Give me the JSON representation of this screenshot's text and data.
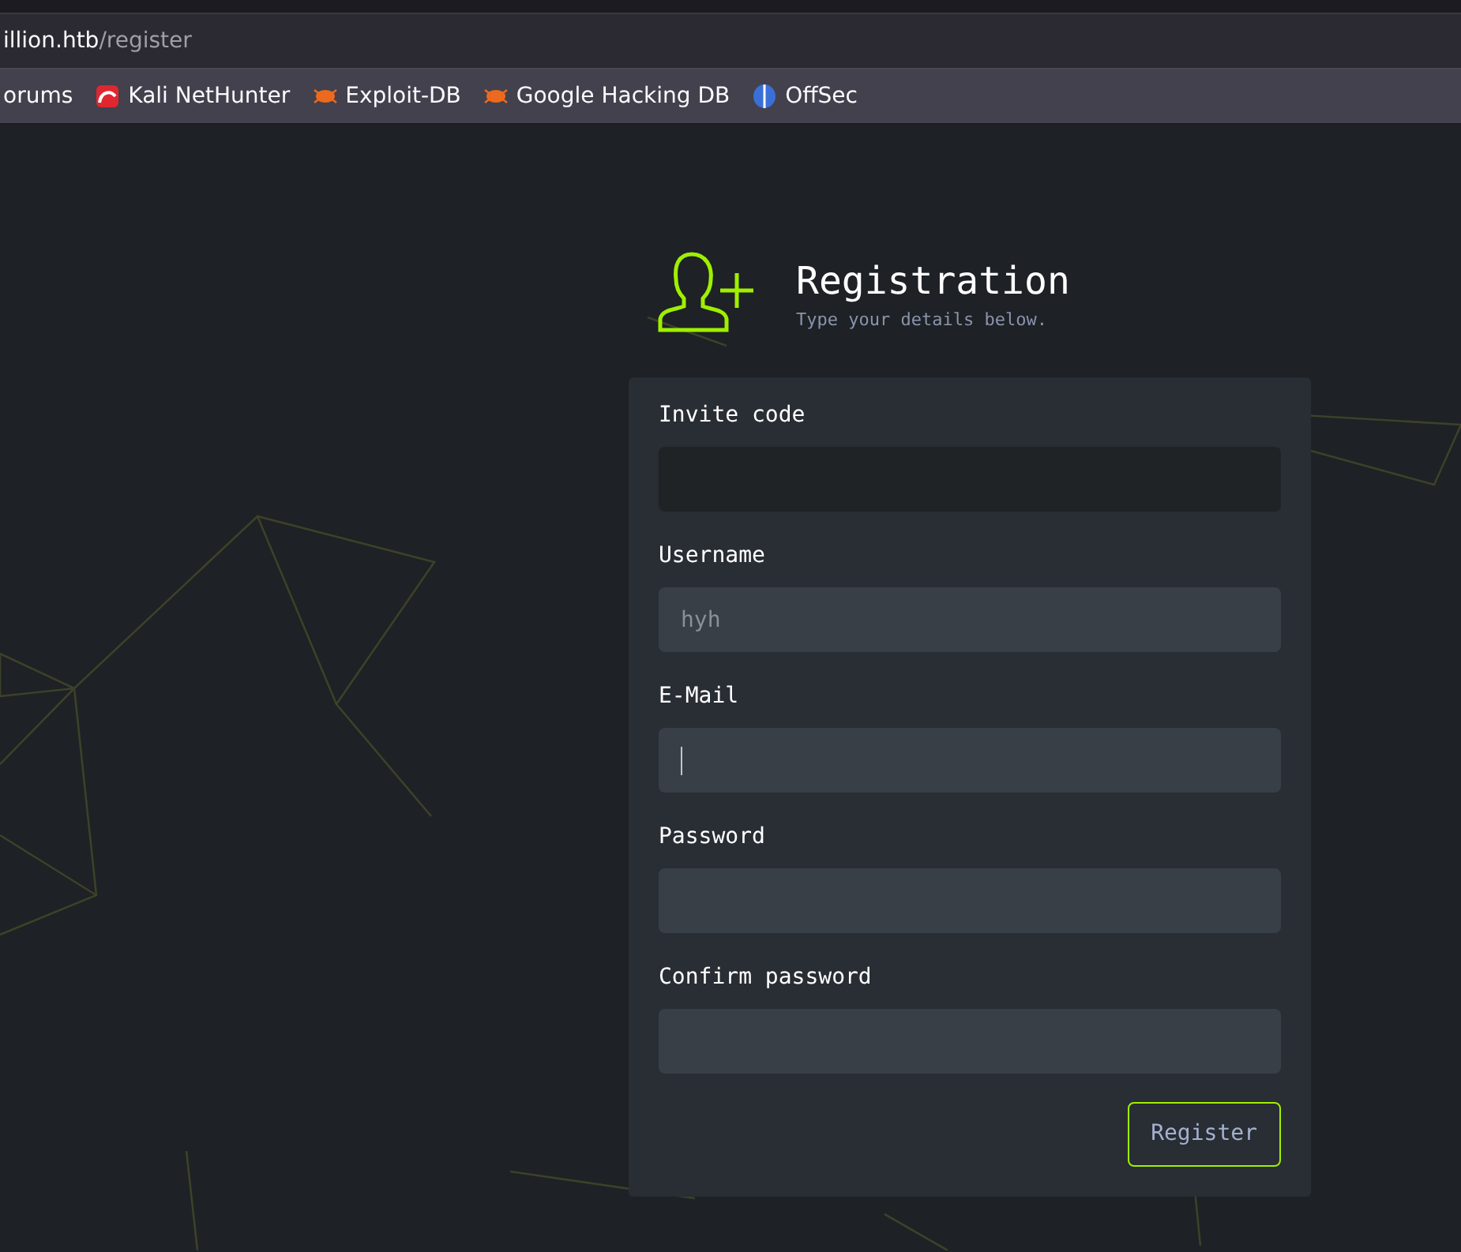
{
  "address_bar": {
    "host": "illion.htb",
    "path": "/register"
  },
  "bookmarks": [
    {
      "label": "orums",
      "kind": "none"
    },
    {
      "label": "Kali NetHunter",
      "kind": "kali"
    },
    {
      "label": "Exploit-DB",
      "kind": "bug"
    },
    {
      "label": "Google Hacking DB",
      "kind": "bug"
    },
    {
      "label": "OffSec",
      "kind": "offsec"
    }
  ],
  "header": {
    "title": "Registration",
    "subtitle": "Type your details below."
  },
  "fields": [
    {
      "label": "Invite code",
      "readonly": true
    },
    {
      "label": "Username",
      "placeholder": "hyh",
      "readonly": false
    },
    {
      "label": "E-Mail",
      "readonly": false,
      "focused": true
    },
    {
      "label": "Password",
      "readonly": false
    },
    {
      "label": "Confirm password",
      "readonly": false
    }
  ],
  "submit": {
    "label": "Register"
  }
}
